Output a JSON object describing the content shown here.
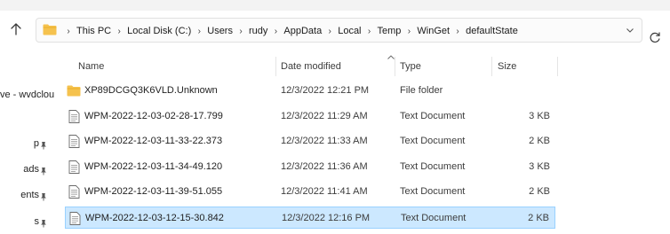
{
  "colors": {
    "selection_bg": "#cce8ff",
    "selection_border": "#99d1ff",
    "folder": "#f5c24e"
  },
  "breadcrumbs": [
    "This PC",
    "Local Disk (C:)",
    "Users",
    "rudy",
    "AppData",
    "Local",
    "Temp",
    "WinGet",
    "defaultState"
  ],
  "nav": {
    "items": [
      {
        "label": "ve - wvdclou",
        "pinned": false
      },
      {
        "label": "p",
        "pinned": true
      },
      {
        "label": "ads",
        "pinned": true
      },
      {
        "label": "ents",
        "pinned": true
      },
      {
        "label": "s",
        "pinned": true
      }
    ]
  },
  "columns": {
    "name": "Name",
    "date": "Date modified",
    "type": "Type",
    "size": "Size"
  },
  "files": [
    {
      "name": "XP89DCGQ3K6VLD.Unknown",
      "date": "12/3/2022 12:21 PM",
      "type": "File folder",
      "size": "",
      "icon": "folder-icon",
      "selected": false
    },
    {
      "name": "WPM-2022-12-03-02-28-17.799",
      "date": "12/3/2022 11:29 AM",
      "type": "Text Document",
      "size": "3 KB",
      "icon": "text-document-icon",
      "selected": false
    },
    {
      "name": "WPM-2022-12-03-11-33-22.373",
      "date": "12/3/2022 11:33 AM",
      "type": "Text Document",
      "size": "2 KB",
      "icon": "text-document-icon",
      "selected": false
    },
    {
      "name": "WPM-2022-12-03-11-34-49.120",
      "date": "12/3/2022 11:36 AM",
      "type": "Text Document",
      "size": "3 KB",
      "icon": "text-document-icon",
      "selected": false
    },
    {
      "name": "WPM-2022-12-03-11-39-51.055",
      "date": "12/3/2022 11:41 AM",
      "type": "Text Document",
      "size": "2 KB",
      "icon": "text-document-icon",
      "selected": false
    },
    {
      "name": "WPM-2022-12-03-12-15-30.842",
      "date": "12/3/2022 12:16 PM",
      "type": "Text Document",
      "size": "2 KB",
      "icon": "text-document-icon",
      "selected": true
    }
  ]
}
